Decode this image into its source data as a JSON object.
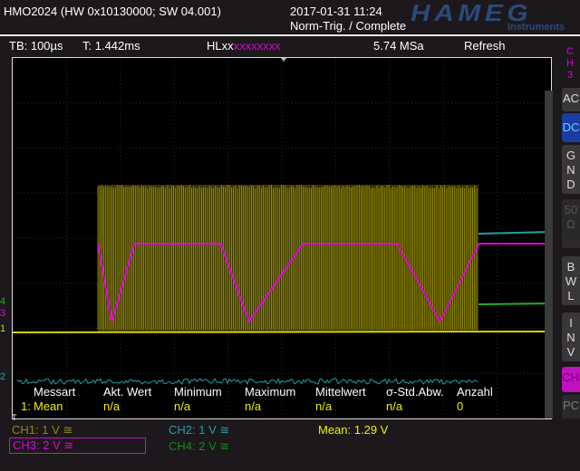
{
  "header": {
    "device": "HMO2024 (HW 0x10130000; SW 04.001)",
    "datetime": "2017-01-31 11:24",
    "trigger_status": "Norm-Trig. / Complete",
    "logo": "HAMEG",
    "logo_sub": "Instruments"
  },
  "status": {
    "timebase": "TB: 100µs",
    "trigger_time": "T: 1.442ms",
    "pattern_prefix": "HLxx",
    "pattern_suffix": "xxxxxxxx",
    "sample_rate": "5.74 MSa",
    "mode": "Refresh"
  },
  "side": {
    "channel": "C H 3",
    "buttons": [
      "AC",
      "DC",
      "G N D",
      "50 Ω",
      "B W L",
      "I N V",
      "CH3",
      "PC"
    ],
    "active": "DC"
  },
  "markers": {
    "ch4": "4",
    "ch3": "3",
    "ch1": "1",
    "ch2": "2",
    "trigger": "T"
  },
  "measurement": {
    "headers": [
      "Messart",
      "Akt. Wert",
      "Minimum",
      "Maximum",
      "Mittelwert",
      "σ-Std.Abw.",
      "Anzahl"
    ],
    "row": {
      "index": "1:",
      "values": [
        "Mean",
        "n/a",
        "n/a",
        "n/a",
        "n/a",
        "n/a",
        "0"
      ]
    }
  },
  "channels": {
    "ch1": "CH1: 1 V ≅",
    "ch2": "CH2: 1 V ≅",
    "ch3": "CH3: 2 V ≅",
    "ch4": "CH4: 2 V ≅",
    "mean": "Mean: 1.29 V"
  },
  "colors": {
    "ch1": "#d8d000",
    "ch2": "#1fa0a8",
    "ch3": "#e000e0",
    "ch4": "#20b020",
    "active": "#1a3ca0"
  }
}
